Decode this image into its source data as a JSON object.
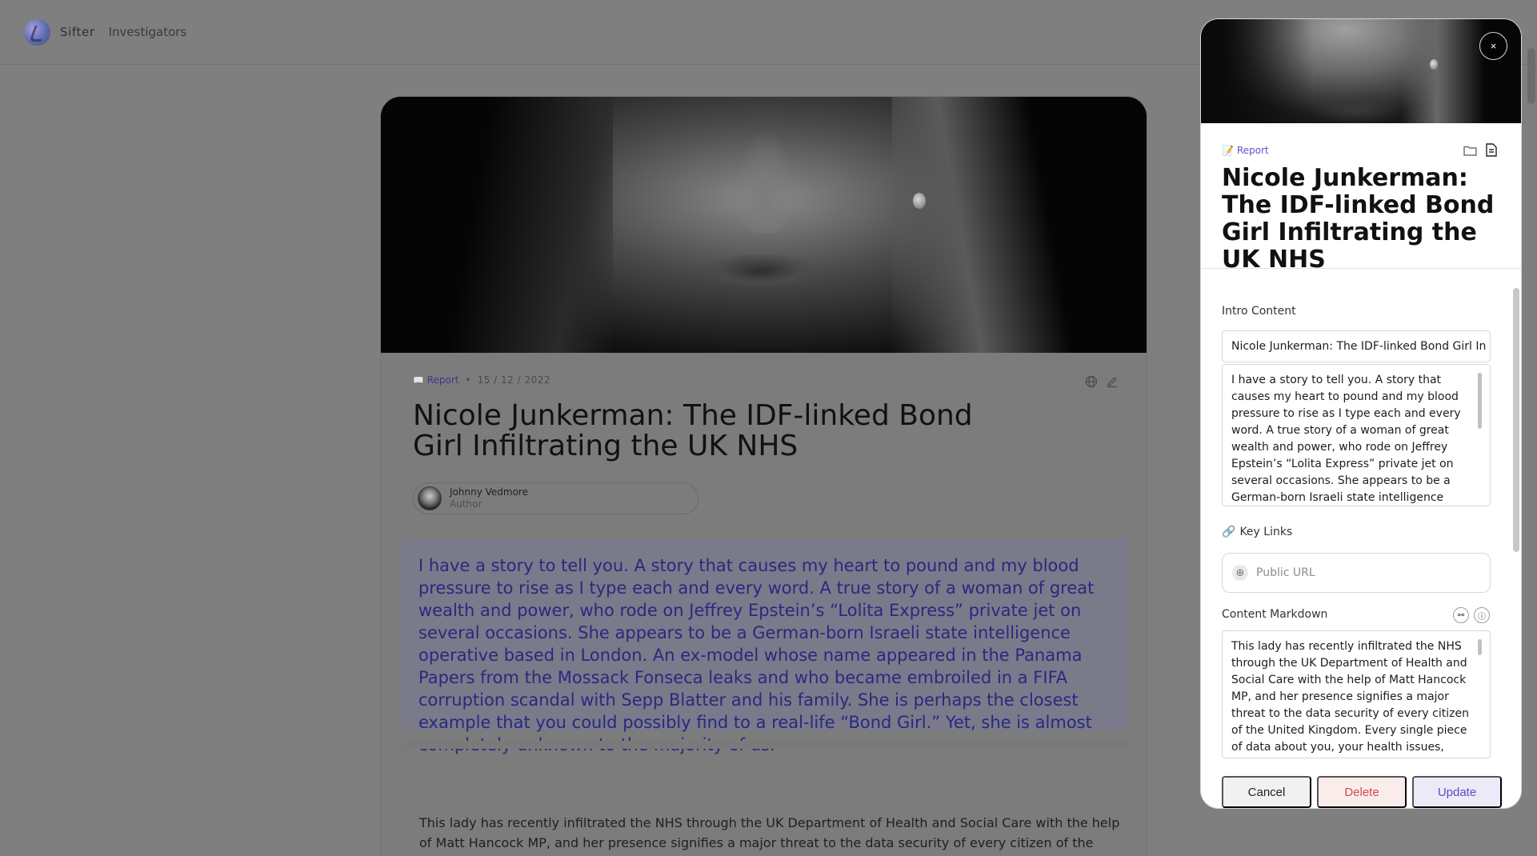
{
  "nav": {
    "brand": "Sifter",
    "link": "Investigators"
  },
  "article": {
    "tag": "Report",
    "date": "15 / 12 / 2022",
    "title": "Nicole Junkerman: The IDF-linked Bond Girl Infiltrating the UK NHS",
    "author_name": "Johnny Vedmore",
    "author_role": "Author",
    "intro": "I have a story to tell you. A story that causes my heart to pound and my blood pressure to rise as I type each and every word. A true story of a woman of great wealth and power, who rode on Jeffrey Epstein’s “Lolita Express” private jet on several occasions. She appears to be a German-born Israeli state intelligence operative based in London. An ex-model whose name appeared in the Panama Papers from the Mossack Fonseca leaks and who became embroiled in a FIFA corruption scandal with Sepp Blatter and his family. She is perhaps the closest example that you could possibly find to a real-life “Bond Girl.” Yet, she is almost completely unknown to the majority of us.",
    "body": "This lady has recently infiltrated the NHS through the UK Department of Health and Social Care with the help of Matt Hancock MP, and her presence signifies a major threat to the data security of every citizen of the"
  },
  "panel": {
    "close_label": "×",
    "tag": "Report",
    "title": "Nicole Junkerman: The IDF-linked Bond Girl Infiltrating the UK NHS",
    "intro_label": "Intro Content",
    "intro_title_value": "Nicole Junkerman: The IDF-linked Bond Girl In",
    "intro_text": "I have a story to tell you. A story that causes my heart to pound and my blood pressure to rise as I type each and every word. A true story of a woman of great wealth and power, who rode on Jeffrey Epstein’s “Lolita Express” private jet on several occasions. She appears to be a German-born Israeli state intelligence",
    "key_links_label": "Key Links",
    "url_placeholder": "Public URL",
    "markdown_label": "Content Markdown",
    "markdown_text": "This lady has recently infiltrated the NHS through the UK Department of Health and Social Care with the help of Matt Hancock MP, and her presence signifies a major threat to the data security of every citizen of the United Kingdom. Every single piece of data about you, your health issues, your",
    "cancel": "Cancel",
    "delete": "Delete",
    "update": "Update"
  },
  "icons": {
    "tag_emoji": "📖",
    "panel_tag_emoji": "📝",
    "link_emoji": "🔗"
  },
  "colors": {
    "accent": "#5b4cc4",
    "danger": "#d24a4a",
    "intro_text": "#2c2780"
  }
}
